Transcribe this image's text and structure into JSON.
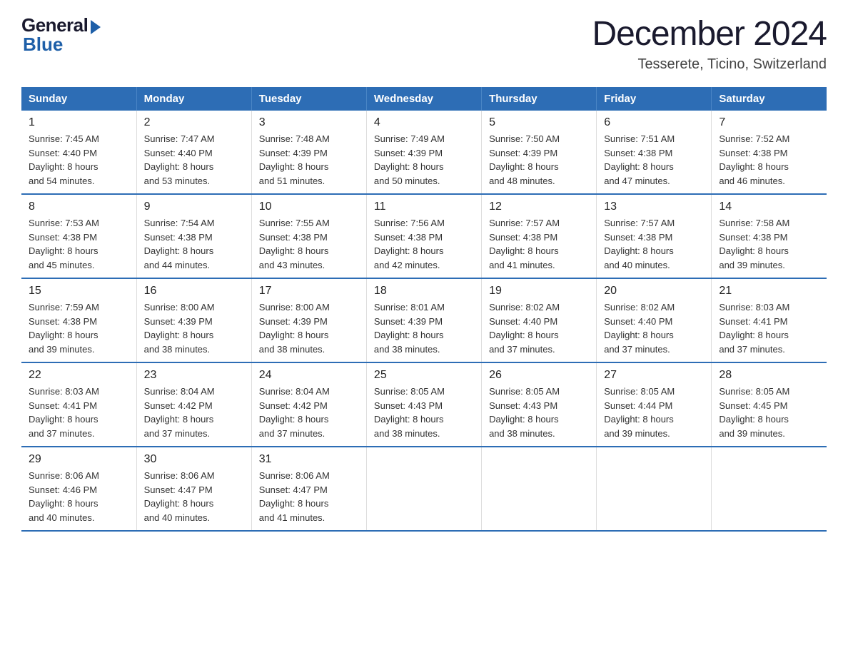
{
  "header": {
    "logo_general": "General",
    "logo_blue": "Blue",
    "month_year": "December 2024",
    "location": "Tesserete, Ticino, Switzerland"
  },
  "days_of_week": [
    "Sunday",
    "Monday",
    "Tuesday",
    "Wednesday",
    "Thursday",
    "Friday",
    "Saturday"
  ],
  "weeks": [
    [
      {
        "day": "1",
        "sunrise": "7:45 AM",
        "sunset": "4:40 PM",
        "daylight": "8 hours and 54 minutes."
      },
      {
        "day": "2",
        "sunrise": "7:47 AM",
        "sunset": "4:40 PM",
        "daylight": "8 hours and 53 minutes."
      },
      {
        "day": "3",
        "sunrise": "7:48 AM",
        "sunset": "4:39 PM",
        "daylight": "8 hours and 51 minutes."
      },
      {
        "day": "4",
        "sunrise": "7:49 AM",
        "sunset": "4:39 PM",
        "daylight": "8 hours and 50 minutes."
      },
      {
        "day": "5",
        "sunrise": "7:50 AM",
        "sunset": "4:39 PM",
        "daylight": "8 hours and 48 minutes."
      },
      {
        "day": "6",
        "sunrise": "7:51 AM",
        "sunset": "4:38 PM",
        "daylight": "8 hours and 47 minutes."
      },
      {
        "day": "7",
        "sunrise": "7:52 AM",
        "sunset": "4:38 PM",
        "daylight": "8 hours and 46 minutes."
      }
    ],
    [
      {
        "day": "8",
        "sunrise": "7:53 AM",
        "sunset": "4:38 PM",
        "daylight": "8 hours and 45 minutes."
      },
      {
        "day": "9",
        "sunrise": "7:54 AM",
        "sunset": "4:38 PM",
        "daylight": "8 hours and 44 minutes."
      },
      {
        "day": "10",
        "sunrise": "7:55 AM",
        "sunset": "4:38 PM",
        "daylight": "8 hours and 43 minutes."
      },
      {
        "day": "11",
        "sunrise": "7:56 AM",
        "sunset": "4:38 PM",
        "daylight": "8 hours and 42 minutes."
      },
      {
        "day": "12",
        "sunrise": "7:57 AM",
        "sunset": "4:38 PM",
        "daylight": "8 hours and 41 minutes."
      },
      {
        "day": "13",
        "sunrise": "7:57 AM",
        "sunset": "4:38 PM",
        "daylight": "8 hours and 40 minutes."
      },
      {
        "day": "14",
        "sunrise": "7:58 AM",
        "sunset": "4:38 PM",
        "daylight": "8 hours and 39 minutes."
      }
    ],
    [
      {
        "day": "15",
        "sunrise": "7:59 AM",
        "sunset": "4:38 PM",
        "daylight": "8 hours and 39 minutes."
      },
      {
        "day": "16",
        "sunrise": "8:00 AM",
        "sunset": "4:39 PM",
        "daylight": "8 hours and 38 minutes."
      },
      {
        "day": "17",
        "sunrise": "8:00 AM",
        "sunset": "4:39 PM",
        "daylight": "8 hours and 38 minutes."
      },
      {
        "day": "18",
        "sunrise": "8:01 AM",
        "sunset": "4:39 PM",
        "daylight": "8 hours and 38 minutes."
      },
      {
        "day": "19",
        "sunrise": "8:02 AM",
        "sunset": "4:40 PM",
        "daylight": "8 hours and 37 minutes."
      },
      {
        "day": "20",
        "sunrise": "8:02 AM",
        "sunset": "4:40 PM",
        "daylight": "8 hours and 37 minutes."
      },
      {
        "day": "21",
        "sunrise": "8:03 AM",
        "sunset": "4:41 PM",
        "daylight": "8 hours and 37 minutes."
      }
    ],
    [
      {
        "day": "22",
        "sunrise": "8:03 AM",
        "sunset": "4:41 PM",
        "daylight": "8 hours and 37 minutes."
      },
      {
        "day": "23",
        "sunrise": "8:04 AM",
        "sunset": "4:42 PM",
        "daylight": "8 hours and 37 minutes."
      },
      {
        "day": "24",
        "sunrise": "8:04 AM",
        "sunset": "4:42 PM",
        "daylight": "8 hours and 37 minutes."
      },
      {
        "day": "25",
        "sunrise": "8:05 AM",
        "sunset": "4:43 PM",
        "daylight": "8 hours and 38 minutes."
      },
      {
        "day": "26",
        "sunrise": "8:05 AM",
        "sunset": "4:43 PM",
        "daylight": "8 hours and 38 minutes."
      },
      {
        "day": "27",
        "sunrise": "8:05 AM",
        "sunset": "4:44 PM",
        "daylight": "8 hours and 39 minutes."
      },
      {
        "day": "28",
        "sunrise": "8:05 AM",
        "sunset": "4:45 PM",
        "daylight": "8 hours and 39 minutes."
      }
    ],
    [
      {
        "day": "29",
        "sunrise": "8:06 AM",
        "sunset": "4:46 PM",
        "daylight": "8 hours and 40 minutes."
      },
      {
        "day": "30",
        "sunrise": "8:06 AM",
        "sunset": "4:47 PM",
        "daylight": "8 hours and 40 minutes."
      },
      {
        "day": "31",
        "sunrise": "8:06 AM",
        "sunset": "4:47 PM",
        "daylight": "8 hours and 41 minutes."
      },
      null,
      null,
      null,
      null
    ]
  ],
  "labels": {
    "sunrise": "Sunrise:",
    "sunset": "Sunset:",
    "daylight": "Daylight:"
  }
}
